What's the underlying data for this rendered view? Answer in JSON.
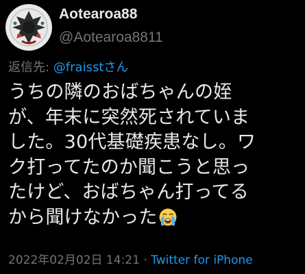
{
  "tweet": {
    "display_name": "Aotearoa88",
    "username": "@Aotearoa8811",
    "reply_prefix": "返信先: ",
    "reply_mention": "@fraisstさん",
    "body_lines": [
      "うちの隣のおばちゃんの姪",
      "が、年末に突然死されていま",
      "した。30代基礎疾患なし。ワ",
      "ク打ってたのか聞こうと思っ",
      "たけど、おばちゃん打ってる",
      "から聞けなかった"
    ],
    "emoji_icon": "loudly-crying-face-icon",
    "timestamp": "2022年02月02日 14:21",
    "separator": " · ",
    "source": "Twitter for iPhone"
  },
  "colors": {
    "background": "#000000",
    "text": "#e7e9ea",
    "secondary": "#71767b",
    "accent": "#1d9bf0"
  }
}
